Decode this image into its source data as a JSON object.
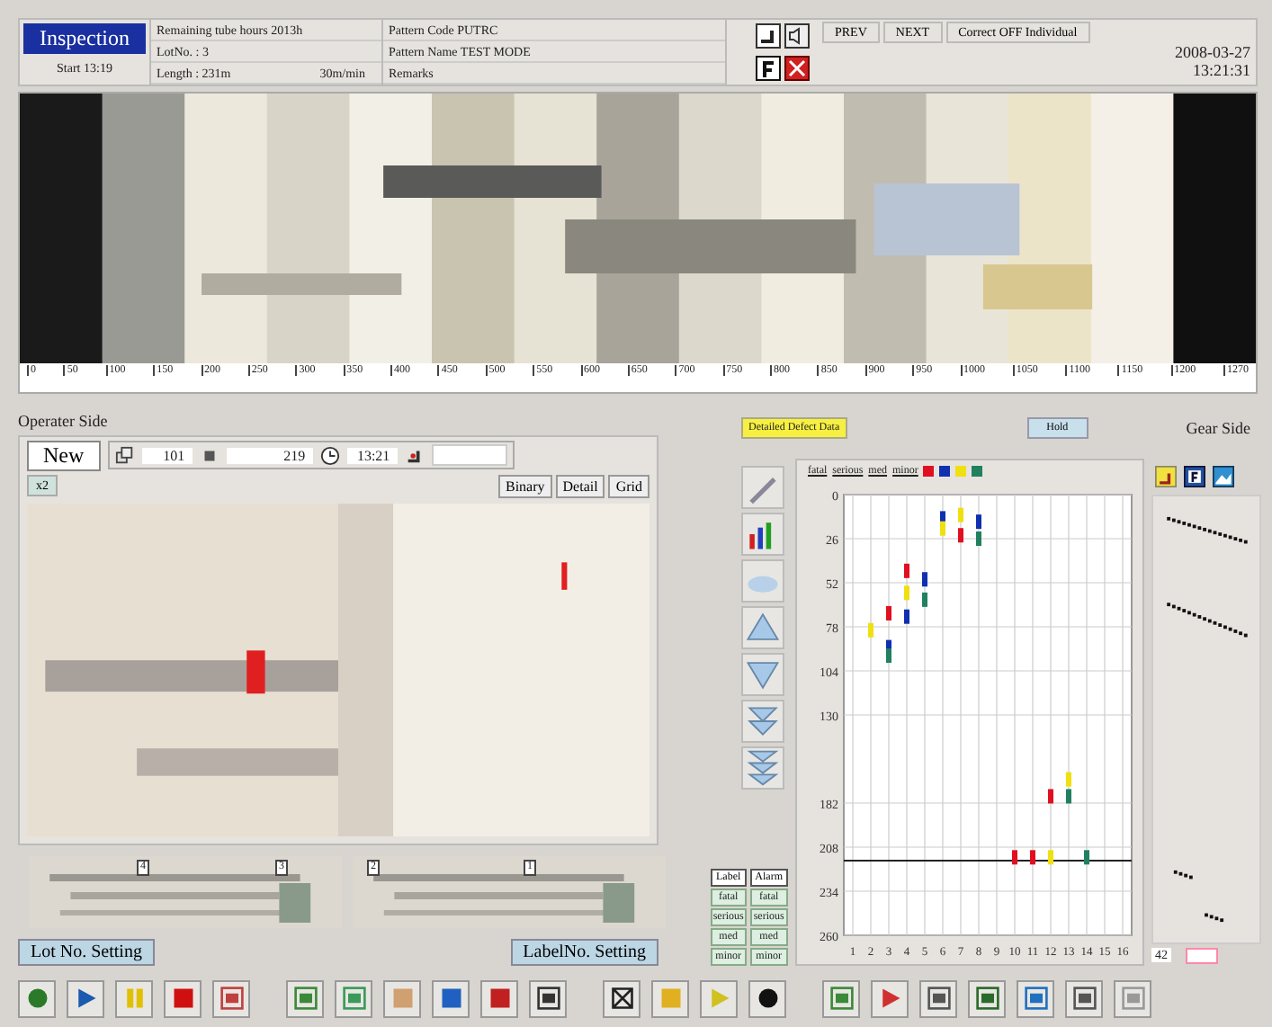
{
  "header": {
    "mode": "Inspection",
    "start": "Start 13:19",
    "info": [
      {
        "text": "Remaining tube hours 2013h"
      },
      {
        "text": "LotNo. : 3"
      },
      {
        "text": "Length : 231m",
        "speed": "30m/min"
      }
    ],
    "pattern": [
      "Pattern Code PUTRC",
      "Pattern Name TEST MODE",
      "Remarks"
    ],
    "buttons": [
      "PREV",
      "NEXT",
      "Correct OFF Individual"
    ],
    "date": "2008-03-27",
    "time": "13:21:31"
  },
  "strip": {
    "scale": [
      "0",
      "50",
      "100",
      "150",
      "200",
      "250",
      "300",
      "350",
      "400",
      "450",
      "500",
      "550",
      "600",
      "650",
      "700",
      "750",
      "800",
      "850",
      "900",
      "950",
      "1000",
      "1050",
      "1100",
      "1150",
      "1200",
      "1270"
    ]
  },
  "operator_side": {
    "title": "Operater Side",
    "new_button": "New",
    "count_a": "101",
    "count_b": "219",
    "clock": "13:21",
    "zoom_button": "x2",
    "view_buttons": [
      "Binary",
      "Detail",
      "Grid"
    ],
    "thumbnails": [
      {
        "marks": [
          "4",
          "3"
        ]
      },
      {
        "marks": [
          "2",
          "1"
        ]
      }
    ],
    "lot_button": "Lot No. Setting",
    "label_button": "LabelNo. Setting"
  },
  "defect_panel": {
    "title": "Detailed Defect Data",
    "hold_button": "Hold",
    "gear_side": "Gear Side",
    "table": {
      "columns": [
        "Label",
        "Alarm"
      ],
      "rows": [
        [
          "fatal",
          "fatal"
        ],
        [
          "serious",
          "serious"
        ],
        [
          "med",
          "med"
        ],
        [
          "minor",
          "minor"
        ]
      ]
    },
    "chart_data": {
      "type": "scatter",
      "x": [
        2,
        3,
        4,
        5,
        6,
        7,
        8,
        10,
        11,
        12,
        13,
        14
      ],
      "xticks": [
        1,
        2,
        3,
        4,
        5,
        6,
        7,
        8,
        9,
        10,
        11,
        12,
        13,
        14,
        15,
        16
      ],
      "xlim": [
        0.5,
        16.5
      ],
      "ylim": [
        260,
        0
      ],
      "grid": true,
      "yticks": [
        0,
        26,
        52,
        78,
        104,
        130,
        182,
        208,
        234,
        260
      ],
      "series": [
        {
          "name": "fatal",
          "color": "#e01020",
          "values": [
            null,
            70,
            45,
            null,
            null,
            24,
            null,
            214,
            214,
            178,
            null,
            null
          ]
        },
        {
          "name": "serious",
          "color": "#1030b0",
          "values": [
            null,
            90,
            72,
            50,
            14,
            null,
            16,
            null,
            null,
            null,
            null,
            null
          ]
        },
        {
          "name": "med",
          "color": "#f0e010",
          "values": [
            80,
            null,
            58,
            null,
            20,
            12,
            null,
            null,
            null,
            214,
            168,
            null
          ]
        },
        {
          "name": "minor",
          "color": "#208060",
          "values": [
            null,
            95,
            null,
            62,
            null,
            null,
            26,
            null,
            null,
            null,
            178,
            214
          ]
        }
      ],
      "ref_lines": [
        {
          "axis": "y",
          "value": 216
        }
      ]
    },
    "trend_value": "42"
  }
}
